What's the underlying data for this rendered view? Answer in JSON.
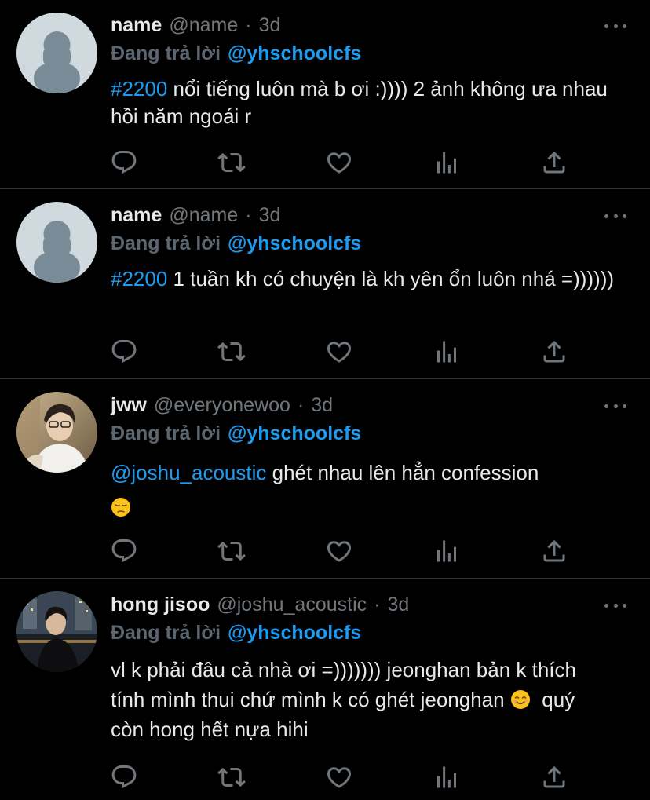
{
  "tweets": [
    {
      "display_name": "name",
      "handle": "@name",
      "separator": "·",
      "time": "3d",
      "reply_prefix": "Đang trả lời",
      "reply_to": "@yhschoolcfs",
      "text_link": "#2200",
      "text_rest": " nổi tiếng luôn mà b ơi :)))) 2 ảnh không ưa nhau hồi năm ngoái r"
    },
    {
      "display_name": "name",
      "handle": "@name",
      "separator": "·",
      "time": "3d",
      "reply_prefix": "Đang trả lời",
      "reply_to": "@yhschoolcfs",
      "text_link": "#2200",
      "text_rest": " 1 tuần kh có chuyện là kh yên ổn luôn nhá =))))))"
    },
    {
      "display_name": "jww",
      "handle": "@everyonewoo",
      "separator": "·",
      "time": "3d",
      "reply_prefix": "Đang trả lời",
      "reply_to": "@yhschoolcfs",
      "text_link": "@joshu_acoustic",
      "text_rest": " ghét nhau lên hẳn confession",
      "emoji": "pensive-face-emoji"
    },
    {
      "display_name": "hong jisoo",
      "handle": "@joshu_acoustic",
      "separator": "·",
      "time": "3d",
      "reply_prefix": "Đang trả lời",
      "reply_to": "@yhschoolcfs",
      "text_part1": "vl k phải đâu cả nhà ơi =))))))) jeonghan bản k thích tính mình thui chứ mình k có ghét jeonghan ",
      "emoji": "smiling-face-emoji",
      "text_part2": "  quý còn hong hết nựa hihi"
    }
  ],
  "icons": {
    "actions": [
      "reply-icon",
      "retweet-icon",
      "like-icon",
      "analytics-icon",
      "share-icon"
    ],
    "more": "more-options-icon"
  },
  "colors": {
    "background": "#000000",
    "primary_text": "#e7e9ea",
    "secondary_text": "#71767b",
    "accent": "#1d9bf0",
    "divider": "#2f3336"
  }
}
